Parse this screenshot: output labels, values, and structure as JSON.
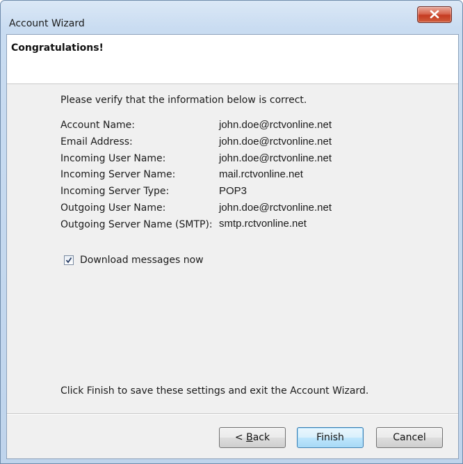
{
  "window": {
    "title": "Account Wizard"
  },
  "header": {
    "title": "Congratulations!"
  },
  "content": {
    "intro": "Please verify that the information below is correct.",
    "rows": [
      {
        "label": "Account Name:",
        "value": "john.doe@rctvonline.net"
      },
      {
        "label": "Email Address:",
        "value": "john.doe@rctvonline.net"
      },
      {
        "label": "Incoming User Name:",
        "value": "john.doe@rctvonline.net"
      },
      {
        "label": "Incoming Server Name:",
        "value": "mail.rctvonline.net"
      },
      {
        "label": "Incoming Server Type:",
        "value": "POP3"
      },
      {
        "label": "Outgoing User Name:",
        "value": "john.doe@rctvonline.net"
      },
      {
        "label": "Outgoing Server Name (SMTP):",
        "value": "smtp.rctvonline.net"
      }
    ],
    "download_checkbox": {
      "label": "Download messages now",
      "checked": true
    },
    "footer_text": "Click Finish to save these settings and exit the Account Wizard."
  },
  "buttons": {
    "back_prefix": "< ",
    "back_accel": "B",
    "back_rest": "ack",
    "finish": "Finish",
    "cancel": "Cancel"
  },
  "icons": {
    "close": "close-icon",
    "check": "checkmark-icon"
  },
  "colors": {
    "title_bar": "#c9dcf1",
    "close_button": "#c53b22",
    "default_button_border": "#3c7fb1"
  }
}
